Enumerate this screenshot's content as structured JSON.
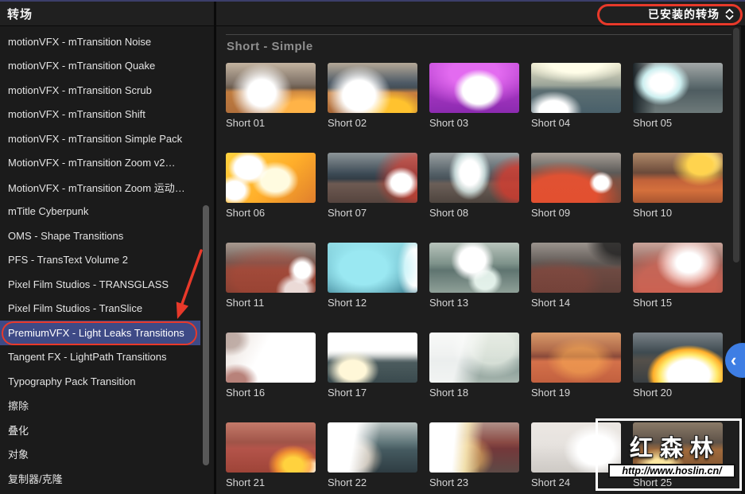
{
  "titlebar": {
    "title": "转场",
    "filter_dropdown": "已安装的转场"
  },
  "sidebar": {
    "items": [
      {
        "label": "motionVFX - mTransition Noise",
        "selected": false
      },
      {
        "label": "motionVFX - mTransition Quake",
        "selected": false
      },
      {
        "label": "motionVFX - mTransition Scrub",
        "selected": false
      },
      {
        "label": "motionVFX - mTransition Shift",
        "selected": false
      },
      {
        "label": "motionVFX - mTransition Simple Pack",
        "selected": false
      },
      {
        "label": "MotionVFX - mTransition Zoom v2…",
        "selected": false
      },
      {
        "label": "MotionVFX - mTransition Zoom 运动…",
        "selected": false
      },
      {
        "label": "mTitle Cyberpunk",
        "selected": false
      },
      {
        "label": "OMS - Shape Transitions",
        "selected": false
      },
      {
        "label": "PFS - TransText Volume 2",
        "selected": false
      },
      {
        "label": "Pixel Film Studios - TRANSGLASS",
        "selected": false
      },
      {
        "label": "Pixel Film Studios - TranSlice",
        "selected": false
      },
      {
        "label": "PremiumVFX - Light Leaks Transitions",
        "selected": true
      },
      {
        "label": "Tangent FX - LightPath Transitions",
        "selected": false
      },
      {
        "label": "Typography Pack Transition",
        "selected": false
      },
      {
        "label": "擦除",
        "selected": false
      },
      {
        "label": "叠化",
        "selected": false
      },
      {
        "label": "对象",
        "selected": false
      },
      {
        "label": "复制器/克隆",
        "selected": false
      }
    ]
  },
  "main": {
    "section_title": "Short - Simple",
    "items": [
      {
        "label": "Short 01",
        "bg": "radial-gradient(55% 95% at 40% 60%, #ffffff 0 28%, #ffffff00 62%), radial-gradient(70% 70% at 85% 100%, #ffb347 0 35%, #ffb34700 70%), linear-gradient(180deg,#c3b3a0 0%,#7d7065 42%,#6b5a4b 50%,#c07c3e 58%,#b06f3c 100%)"
      },
      {
        "label": "Short 02",
        "bg": "radial-gradient(60% 100% at 35% 65%, #ffffff 0 30%, #ffffff00 60%), radial-gradient(55% 55% at 70% 95%, #ffc22e 0 40%, #ffc22e00 75%), linear-gradient(180deg,#b4a897 0%,#4e5a66 40%,#454f56 50%,#c9803f 60%,#a86838 100%)"
      },
      {
        "label": "Short 03",
        "bg": "radial-gradient(40% 60% at 55% 55%, #ffffff 0 45%, #ffffff00 70%), radial-gradient(90% 90% at 50% 20%, #e36bf0 0 30%, #e36bf000 75%), linear-gradient(180deg,#c24ad8 0%,#a937c4 45%,#8c2bb0 100%)"
      },
      {
        "label": "Short 04",
        "bg": "radial-gradient(45% 55% at 25% 95%, #ffffff 0 35%, #ffffff00 70%), radial-gradient(80% 55% at 50% 0%, #fffde8 0 35%, #fffde800 75%), linear-gradient(180deg,#e8e4c8 0%,#9aa398 45%,#5c6e72 55%,#49606a 100%)"
      },
      {
        "label": "Short 05",
        "bg": "radial-gradient(42% 60% at 32% 40%, #ffffff 0 30%, #cdeff0 50%, #cdeff000 75%), linear-gradient(90deg,#1c2428 0%, #1c242800 25%), linear-gradient(180deg,#a3a8a8 0%,#5d6b6e 45%,#4e5c60 55%,#6e7a7a 100%)"
      },
      {
        "label": "Short 06",
        "bg": "radial-gradient(30% 45% at 25% 30%, #ffffff 0 50%, #ffffff00 75%), radial-gradient(35% 50% at 55% 55%, #fffbe0 0 45%, #fffbe000 75%), radial-gradient(25% 40% at 10% 75%, #ffffff 0 45%, #ffffff00 75%), linear-gradient(135deg,#ffd23e 0%,#ffae2a 55%,#e07f2c 100%)"
      },
      {
        "label": "Short 07",
        "bg": "radial-gradient(28% 45% at 82% 60%, #ffffff 0 40%, #ffffff00 70%), radial-gradient(60% 90% at 100% 50%, #e8392a99 0 45%, #e8392a00 80%), linear-gradient(180deg,#8d9598 0%,#3c4a55 42%,#333d46 52%,#6e5a52 62%,#55443e 100%)"
      },
      {
        "label": "Short 08",
        "bg": "radial-gradient(30% 70% at 45% 40%, #ffffff 0 35%, #dff2f0cc 55%, #dff2f000 78%), radial-gradient(45% 70% at 100% 60%, #d63b2ecc 0 45%, #d63b2e00 80%), linear-gradient(180deg,#9aa0a2 0%,#535f66 42%,#49535a 52%,#6b5f58 62%,#4e443e 100%)"
      },
      {
        "label": "Short 09",
        "bg": "radial-gradient(18% 30% at 78% 60%, #ffffff 0 45%, #ffffff00 75%), radial-gradient(75% 80% at 35% 85%, #f0512fdd 0 50%, #f0512f00 85%), linear-gradient(180deg,#a79f96 0%,#5c5a58 40%,#7c5244 55%,#8a4a36 100%)"
      },
      {
        "label": "Short 10",
        "bg": "radial-gradient(45% 60% at 75% 25%, #ffd34e 0 30%, #ffd34e00 70%), radial-gradient(30% 40% at 80% 20%, #fff6c0 0 35%, #fff6c000 70%), linear-gradient(180deg,#b08a6a 0%,#6b4a3a 40%,#c2623a 55%,#d4703c 75%,#a85530 100%)"
      },
      {
        "label": "Short 11",
        "bg": "radial-gradient(22% 40% at 85% 55%, #ffffff 0 40%, #ffffff00 72%), radial-gradient(30% 45% at 78% 95%, #ffffffcc 0 40%, #ffffff00 75%), radial-gradient(80% 80% at 50% 70%, #c44a3666 0 50%, #c44a3600 85%), linear-gradient(180deg,#a89a90 0%,#6d5a54 40%,#8a4a3c 55%,#7c3f32 100%)"
      },
      {
        "label": "Short 12",
        "bg": "radial-gradient(75% 95% at 40% 50%, #9ae8f2 0 35%, #9ae8f266 65%, #9ae8f200 85%), radial-gradient(25% 80% at 97% 50%, #ffffff 0 45%, #ffffff00 80%), linear-gradient(180deg,#8fd8e0 0%,#5da8b8 45%,#3f8294 100%)"
      },
      {
        "label": "Short 13",
        "bg": "radial-gradient(32% 55% at 48% 35%, #ffffff 0 45%, #ffffff00 75%), radial-gradient(25% 40% at 62% 75%, #f2fff8dd 0 45%, #f2fff800 78%), linear-gradient(180deg,#b8c4bc 0%,#7e928a 42%,#5f7470 55%,#8fa098 100%)"
      },
      {
        "label": "Short 14",
        "bg": "radial-gradient(55% 70% at 100% 0%, #1c1c1ccc 0 35%, #1c1c1c00 70%), radial-gradient(60% 60% at 30% 80%, #9a463a55 0 50%, #9a463a00 85%), linear-gradient(180deg,#9b948e 0%,#5f5854 42%,#6e4a42 55%,#604039 100%)"
      },
      {
        "label": "Short 15",
        "bg": "radial-gradient(45% 65% at 62% 40%, #ffffff 0 30%, #ffe4e0aa 55%, #ffe4e000 80%), radial-gradient(85% 85% at 50% 80%, #e86a5899 0 50%, #e86a5800 85%), linear-gradient(180deg,#c9a49a 0%,#8d6058 45%,#a05648 100%)"
      },
      {
        "label": "Short 16",
        "bg": "radial-gradient(40% 55% at 12% 95%, #b8827a 0 25%, #b8827a00 60%), radial-gradient(35% 50% at 5% 15%, #a89088aa 0 30%, #a8908800 65%), linear-gradient(120deg,#e8ded8 0%,#ffffff 40%,#ffffff 100%)"
      },
      {
        "label": "Short 17",
        "bg": "radial-gradient(42% 55% at 28% 75%, #fff7d8 0 35%, #fff7d800 70%), linear-gradient(180deg, #ffffff 0 35%, #ffffff00 60%), linear-gradient(180deg,#e8e8e0 0%,#c8ccc4 38%,#4e5e60 55%,#3a4a4e 100%)"
      },
      {
        "label": "Short 18",
        "bg": "linear-gradient(105deg, #ffffffdd 0 35%, #ffffff22 60%), radial-gradient(60% 80% at 70% 30%, #e8efe4cc 0 40%, #e8efe400 75%), linear-gradient(180deg,#cfd6cc 0%,#8a9a94 45%,#68807c 55%,#9aaba2 100%)"
      },
      {
        "label": "Short 19",
        "bg": "radial-gradient(50% 60% at 55% 55%, #ffb05488 0 40%, #ffb05400 75%), linear-gradient(180deg,#d89a6a 0%,#b06a4a 35%,#8a4a3a 48%,#d4714a 58%,#c2603f 100%)"
      },
      {
        "label": "Short 20",
        "bg": "radial-gradient(58% 75% at 62% 85%, #ffffff 0 40%, #ffe86a 55%, #ffae2a 68%, #ffae2a00 80%), linear-gradient(180deg,#7a8288 0%,#3e4a50 40%,#55504a 55%,#3a3f42 100%)"
      },
      {
        "label": "Short 21",
        "bg": "radial-gradient(35% 50% at 75% 85%, #ffd23e 0 30%, #ff9e2ecc 55%, #ff9e2e00 80%), radial-gradient(25% 35% at 95% 95%, #ffffff 0 40%, #ffffff00 70%), linear-gradient(180deg,#c47a6a 0%,#a05448 40%,#b4544a 52%,#9e4438 100%)"
      },
      {
        "label": "Short 22",
        "bg": "linear-gradient(100deg, #ffffff 0 30%, #ffffff00 55%), radial-gradient(45% 65% at 30% 70%, #ffe8d0aa 0 35%, #ffe8d000 70%), linear-gradient(180deg,#b8c2c0 0%,#5e7478 42%,#455a60 55%,#2e3c42 100%)"
      },
      {
        "label": "Short 23",
        "bg": "linear-gradient(95deg, #ffffff 0 28%, #fff3c0cc 42%, #ffffff00 58%), radial-gradient(40% 60% at 42% 70%, #ffca6a88 0 40%, #ffca6a00 75%), linear-gradient(180deg,#b09088 0%,#8a4a44 40%,#74383a 52%,#5e4a46 100%)"
      },
      {
        "label": "Short 24",
        "bg": "radial-gradient(45% 65% at 72% 55%, #ffffff 0 45%, #ffffff00 80%), linear-gradient(180deg, #f0ece8dd 0 45%, #d8d4d0aa 100%), linear-gradient(180deg,#cfc8c2 0%,#a8a4a0 45%,#b8b4ae 100%)"
      },
      {
        "label": "Short 25",
        "bg": "radial-gradient(40% 55% at 30% 90%, #ffe8a0 0 30%, #ffe8a000 70%), linear-gradient(180deg,#8a7a68 0%,#5e5248 40%,#a06a3c 55%,#7c5230 100%)"
      }
    ]
  },
  "panel_toggle": {
    "chevron": "‹",
    "color": "#3e7ee4"
  },
  "watermark": {
    "title": "红森林",
    "url": "http://www.hoslin.cn/"
  },
  "annotations": {
    "color": "#e8392a"
  }
}
